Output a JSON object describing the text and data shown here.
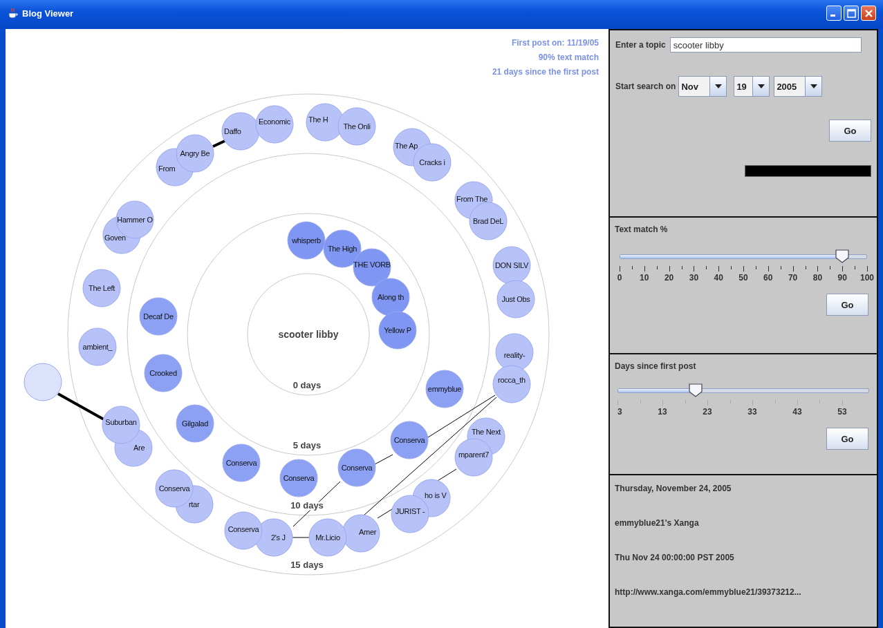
{
  "window": {
    "title": "Blog Viewer"
  },
  "graph": {
    "info": [
      "First post on: 11/19/05",
      "90% text match",
      "21 days since the first post"
    ],
    "center": "scooter libby",
    "rings": [
      {
        "label": "0 days"
      },
      {
        "label": "5 days"
      },
      {
        "label": "10 days"
      },
      {
        "label": "15 days"
      }
    ],
    "nodes": [
      {
        "label": "From",
        "color": "#b7c3f8"
      },
      {
        "label": "Angry Be",
        "color": "#b7c3f8"
      },
      {
        "label": "Daffo",
        "color": "#b7c3f8"
      },
      {
        "label": "Economic",
        "color": "#b7c3f8"
      },
      {
        "label": "The H",
        "color": "#b7c3f8"
      },
      {
        "label": "The Onli",
        "color": "#b7c3f8"
      },
      {
        "label": "The Ap",
        "color": "#b7c3f8"
      },
      {
        "label": "Cracks i",
        "color": "#b7c3f8"
      },
      {
        "label": "From The",
        "color": "#b7c3f8"
      },
      {
        "label": "Brad DeL",
        "color": "#b7c3f8"
      },
      {
        "label": "Goven",
        "color": "#b7c3f8"
      },
      {
        "label": "Hammer O",
        "color": "#b7c3f8"
      },
      {
        "label": "whisperb",
        "color": "#7f96f2"
      },
      {
        "label": "The High",
        "color": "#7f96f2"
      },
      {
        "label": "THE VORB",
        "color": "#7f96f2"
      },
      {
        "label": "DON SILV",
        "color": "#b7c3f8"
      },
      {
        "label": "Just Obs",
        "color": "#b7c3f8"
      },
      {
        "label": "The Left",
        "color": "#b7c3f8"
      },
      {
        "label": "Along th",
        "color": "#7f96f2"
      },
      {
        "label": "Decaf De",
        "color": "#8ca1f3"
      },
      {
        "label": "Yellow P",
        "color": "#7f96f2"
      },
      {
        "label": "ambient_",
        "color": "#b7c3f8"
      },
      {
        "label": "reality-",
        "color": "#b7c3f8"
      },
      {
        "label": "rocca_th",
        "color": "#b7c3f8"
      },
      {
        "label": "Crooked",
        "color": "#8ca1f3"
      },
      {
        "color": "#dde2fb"
      },
      {
        "label": "emmyblue",
        "color": "#8ca1f3"
      },
      {
        "label": "Are",
        "color": "#b7c3f8"
      },
      {
        "label": "Suburban",
        "color": "#b7c3f8"
      },
      {
        "label": "Gilgalad",
        "color": "#8ca1f3"
      },
      {
        "label": "The Next",
        "color": "#b7c3f8"
      },
      {
        "label": "mparent7",
        "color": "#b7c3f8"
      },
      {
        "label": "Conserva",
        "color": "#8ca1f3"
      },
      {
        "label": "Conserva",
        "color": "#8ca1f3"
      },
      {
        "label": "Conserva",
        "color": "#8ca1f3"
      },
      {
        "label": "Conserva",
        "color": "#8ca1f3"
      },
      {
        "label": "rtar",
        "color": "#b7c3f8"
      },
      {
        "label": "Conserva",
        "color": "#b7c3f8"
      },
      {
        "label": "ho is V",
        "color": "#b7c3f8"
      },
      {
        "label": "JURIST -",
        "color": "#b7c3f8"
      },
      {
        "label": "2's J",
        "color": "#b7c3f8"
      },
      {
        "label": "Conserva",
        "color": "#b7c3f8"
      },
      {
        "label": "Amer",
        "color": "#b7c3f8"
      },
      {
        "label": "Mr.Licio",
        "color": "#b7c3f8"
      }
    ]
  },
  "search": {
    "topic_label": "Enter a topic",
    "topic_value": "scooter libby",
    "start_label": "Start search on",
    "dropdowns": [
      {
        "value": "Nov"
      },
      {
        "value": "19"
      },
      {
        "value": "2005"
      }
    ],
    "go": "Go",
    "progress": {
      "level": 1
    }
  },
  "sliders": [
    {
      "title": "Text match %",
      "level": 0.9,
      "ticks": [
        "0",
        "10",
        "20",
        "30",
        "40",
        "50",
        "60",
        "70",
        "80",
        "90",
        "100"
      ],
      "go": "Go"
    },
    {
      "title": "Days since first post",
      "level": 0.31,
      "ticks": [
        "3",
        "13",
        "23",
        "33",
        "43",
        "53"
      ],
      "go": "Go"
    }
  ],
  "details": [
    "Thursday, November 24, 2005",
    "emmyblue21's Xanga",
    "Thu Nov 24 00:00:00 PST 2005",
    "http://www.xanga.com/emmyblue21/39373212..."
  ]
}
